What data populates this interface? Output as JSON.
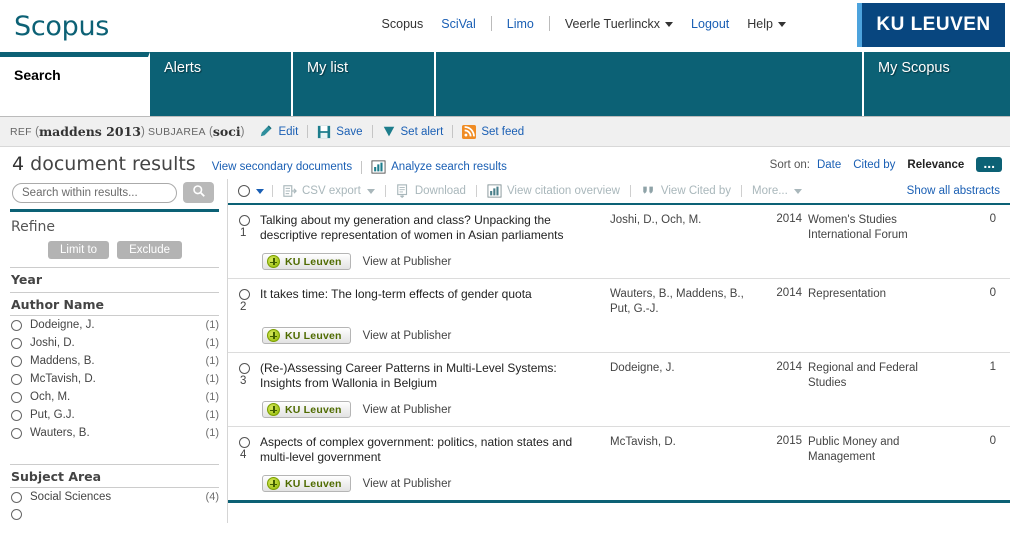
{
  "header": {
    "logo": "Scopus",
    "nav": [
      {
        "label": "Scopus",
        "current": true
      },
      {
        "label": "SciVal",
        "current": false
      },
      {
        "label": "Limo",
        "current": false
      }
    ],
    "user": "Veerle Tuerlinckx",
    "logout": "Logout",
    "help": "Help",
    "institution_logo": "KU LEUVEN"
  },
  "tabs": [
    {
      "label": "Search",
      "active": true
    },
    {
      "label": "Alerts",
      "active": false
    },
    {
      "label": "My list",
      "active": false
    },
    {
      "label": "My Scopus",
      "active": false
    }
  ],
  "query": {
    "ref_label": "REF",
    "ref_value": "maddens 2013",
    "subjarea_label": "SUBJAREA",
    "subjarea_value": "soci",
    "actions": [
      {
        "label": "Edit",
        "icon": "edit-pencil-icon"
      },
      {
        "label": "Save",
        "icon": "floppy-disk-icon"
      },
      {
        "label": "Set alert",
        "icon": "alert-bell-icon"
      },
      {
        "label": "Set feed",
        "icon": "rss-feed-icon"
      }
    ]
  },
  "results_header": {
    "count": "4",
    "count_label": "document results",
    "secondary_link": "View secondary documents",
    "analyze_link": "Analyze search results",
    "analyze_icon": "bar-chart-icon",
    "sort_label": "Sort on:",
    "sort_options": [
      {
        "label": "Date",
        "active": false
      },
      {
        "label": "Cited by",
        "active": false
      },
      {
        "label": "Relevance",
        "active": true
      }
    ],
    "more_sort": "..."
  },
  "sidebar": {
    "search_placeholder": "Search within results...",
    "search_value": "",
    "search_icon": "magnifier-icon",
    "refine_title": "Refine",
    "limit_to": "Limit to",
    "exclude": "Exclude",
    "facets": [
      {
        "title": "Year",
        "items": []
      },
      {
        "title": "Author Name",
        "items": [
          {
            "label": "Dodeigne, J.",
            "count": "(1)"
          },
          {
            "label": "Joshi, D.",
            "count": "(1)"
          },
          {
            "label": "Maddens, B.",
            "count": "(1)"
          },
          {
            "label": "McTavish, D.",
            "count": "(1)"
          },
          {
            "label": "Och, M.",
            "count": "(1)"
          },
          {
            "label": "Put, G.J.",
            "count": "(1)"
          },
          {
            "label": "Wauters, B.",
            "count": "(1)"
          }
        ]
      },
      {
        "title": "Subject Area",
        "items": [
          {
            "label": "Social Sciences",
            "count": "(4)"
          }
        ]
      }
    ]
  },
  "toolbar": {
    "select_all_icon": "checkbox-dropdown-icon",
    "items": [
      {
        "label": "CSV export",
        "icon": "csv-export-icon",
        "has_caret": true,
        "disabled": true
      },
      {
        "label": "Download",
        "icon": "download-icon",
        "has_caret": false,
        "disabled": true
      },
      {
        "label": "View citation overview",
        "icon": "bar-chart-icon",
        "has_caret": false,
        "disabled": true
      },
      {
        "label": "View Cited by",
        "icon": "quote-icon",
        "has_caret": false,
        "disabled": true
      },
      {
        "label": "More...",
        "icon": "",
        "has_caret": true,
        "disabled": true
      }
    ],
    "show_all_abstracts": "Show all abstracts"
  },
  "results": [
    {
      "number": "1",
      "title": "Talking about my generation and class? Unpacking the descriptive representation of women in Asian parliaments",
      "authors": "Joshi, D., Och, M.",
      "year": "2014",
      "source": "Women's Studies International Forum",
      "cited_by": "0",
      "kul_button": "KU Leuven",
      "publisher_link": "View at Publisher"
    },
    {
      "number": "2",
      "title": "It takes time: The long-term effects of gender quota",
      "authors": "Wauters, B., Maddens, B., Put, G.-J.",
      "year": "2014",
      "source": "Representation",
      "cited_by": "0",
      "kul_button": "KU Leuven",
      "publisher_link": "View at Publisher"
    },
    {
      "number": "3",
      "title": "(Re-)Assessing Career Patterns in Multi-Level Systems: Insights from Wallonia in Belgium",
      "authors": "Dodeigne, J.",
      "year": "2014",
      "source": "Regional and Federal Studies",
      "cited_by": "1",
      "kul_button": "KU Leuven",
      "publisher_link": "View at Publisher"
    },
    {
      "number": "4",
      "title": "Aspects of complex government: politics, nation states and multi-level government",
      "authors": "McTavish, D.",
      "year": "2015",
      "source": "Public Money and Management",
      "cited_by": "0",
      "kul_button": "KU Leuven",
      "publisher_link": "View at Publisher"
    }
  ],
  "colors": {
    "teal": "#0c6175",
    "link_blue": "#1a5fb4",
    "kul_blue": "#08467f",
    "kul_stripe": "#4da3dd",
    "kul_green": "#8db600"
  }
}
